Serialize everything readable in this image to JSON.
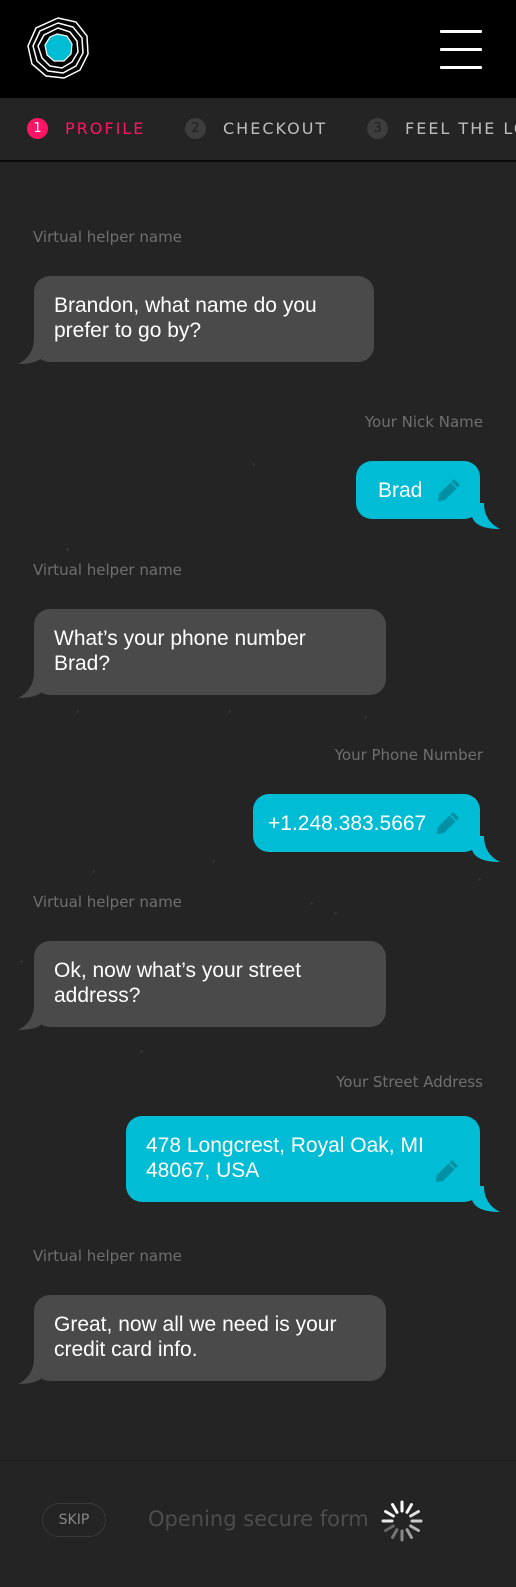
{
  "header": {
    "logo_icon": "topographic-logo-icon",
    "menu_icon": "hamburger-menu-icon"
  },
  "steps": [
    {
      "number": "1",
      "label": "PROFILE",
      "active": true
    },
    {
      "number": "2",
      "label": "CHECKOUT",
      "active": false
    },
    {
      "number": "3",
      "label": "FEEL THE LO",
      "active": false
    }
  ],
  "conversation": [
    {
      "from": "bot",
      "sender": "Virtual helper name",
      "text": "Brandon, what name do you prefer to go by?"
    },
    {
      "from": "user",
      "sender": "Your Nick Name",
      "text": "Brad"
    },
    {
      "from": "bot",
      "sender": "Virtual helper name",
      "text": "What’s your phone number Brad?"
    },
    {
      "from": "user",
      "sender": "Your Phone Number",
      "text": "+1.248.383.5667"
    },
    {
      "from": "bot",
      "sender": "Virtual helper name",
      "text": "Ok, now what’s your street address?"
    },
    {
      "from": "user",
      "sender": "Your Street Address",
      "text": "478 Longcrest, Royal Oak, MI 48067, USA"
    },
    {
      "from": "bot",
      "sender": "Virtual helper name",
      "text": "Great, now all we need is your credit card info."
    }
  ],
  "footer": {
    "skip_label": "SKIP",
    "status_text": "Opening secure form",
    "spinner_icon": "loading-spinner-icon"
  },
  "colors": {
    "accent": "#ff1466",
    "user_bubble": "#00bcd4",
    "bot_bubble": "#4a4a4a",
    "background": "#242424"
  }
}
